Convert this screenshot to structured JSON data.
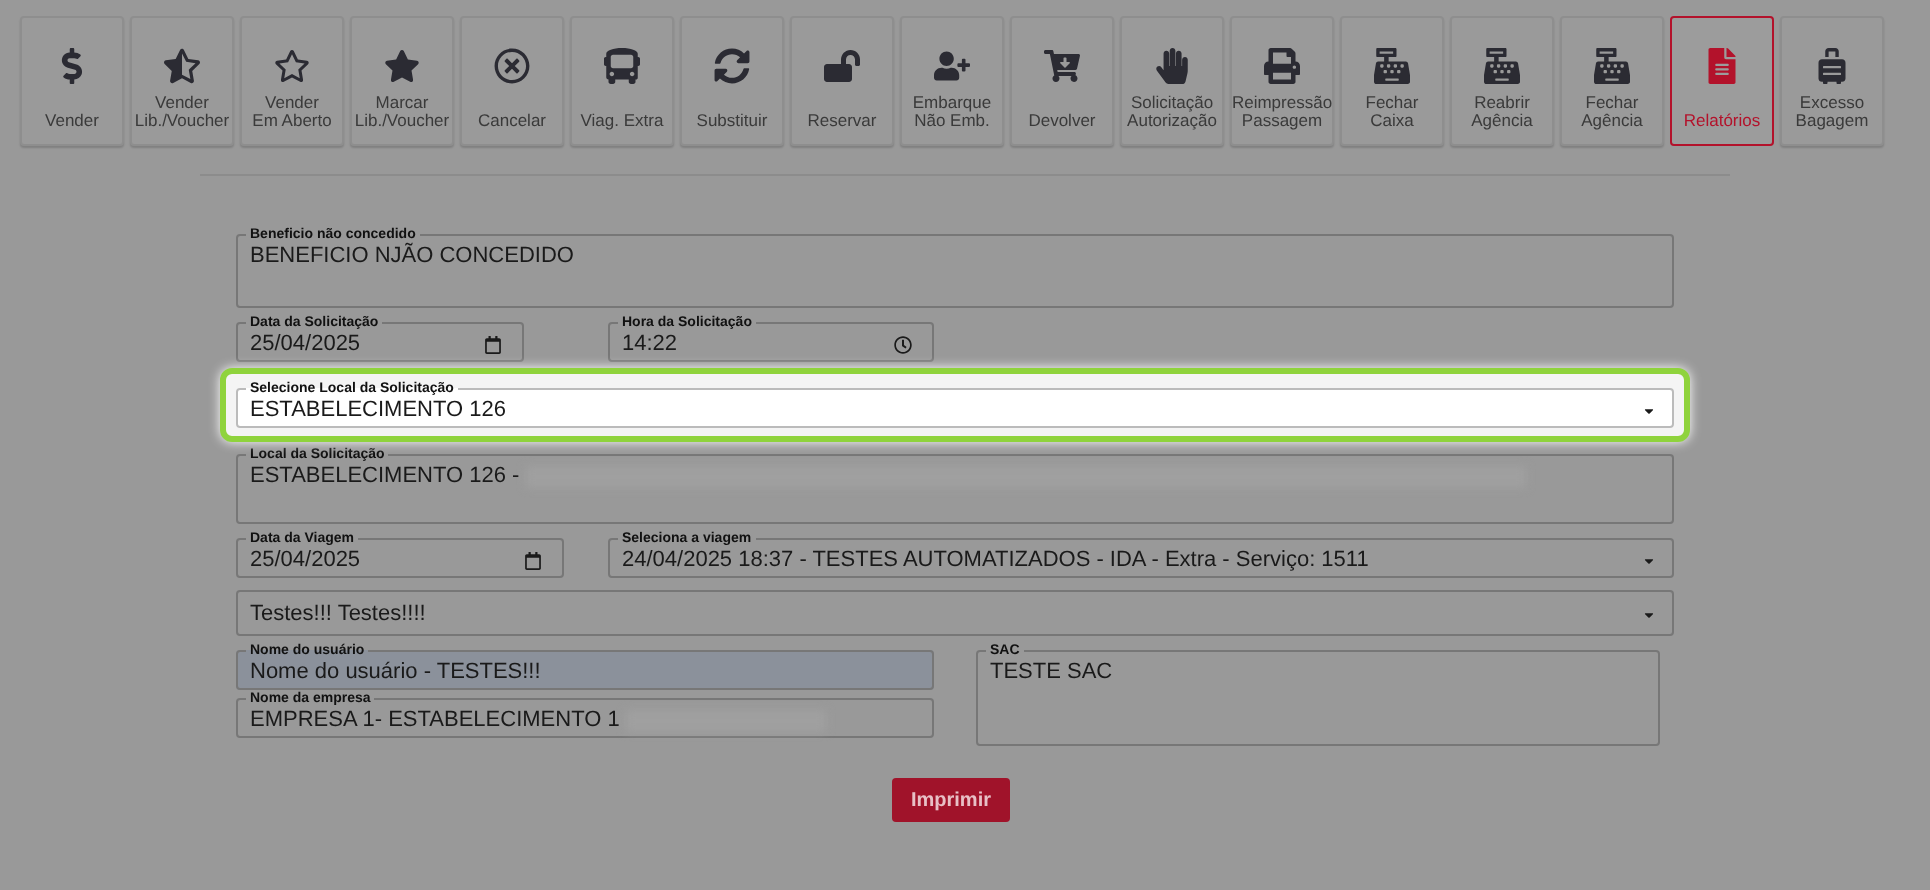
{
  "toolbar": {
    "buttons": [
      {
        "lines": [
          "Vender"
        ],
        "selected": false
      },
      {
        "lines": [
          "Vender",
          "Lib./Voucher"
        ],
        "selected": false
      },
      {
        "lines": [
          "Vender",
          "Em Aberto"
        ],
        "selected": false
      },
      {
        "lines": [
          "Marcar",
          "Lib./Voucher"
        ],
        "selected": false
      },
      {
        "lines": [
          "Cancelar"
        ],
        "selected": false
      },
      {
        "lines": [
          "Viag. Extra"
        ],
        "selected": false
      },
      {
        "lines": [
          "Substituir"
        ],
        "selected": false
      },
      {
        "lines": [
          "Reservar"
        ],
        "selected": false
      },
      {
        "lines": [
          "Embarque",
          "Não Emb."
        ],
        "selected": false
      },
      {
        "lines": [
          "Devolver"
        ],
        "selected": false
      },
      {
        "lines": [
          "Solicitação",
          "Autorização"
        ],
        "selected": false
      },
      {
        "lines": [
          "Reimpressão",
          "Passagem"
        ],
        "selected": false
      },
      {
        "lines": [
          "Fechar",
          "Caixa"
        ],
        "selected": false
      },
      {
        "lines": [
          "Reabrir",
          "Agência"
        ],
        "selected": false
      },
      {
        "lines": [
          "Fechar",
          "Agência"
        ],
        "selected": false
      },
      {
        "lines": [
          "Relatórios"
        ],
        "selected": true
      },
      {
        "lines": [
          "Excesso",
          "Bagagem"
        ],
        "selected": false
      }
    ]
  },
  "form": {
    "beneficio": {
      "label": "Beneficio não concedido",
      "value": "BENEFICIO NJÃO CONCEDIDO"
    },
    "data_solicitacao": {
      "label": "Data da Solicitação",
      "value": "25/04/2025"
    },
    "hora_solicitacao": {
      "label": "Hora da Solicitação",
      "value": "14:22"
    },
    "local_select": {
      "label": "Selecione Local da Solicitação",
      "value": "ESTABELECIMENTO 126",
      "highlighted": true
    },
    "local_solicitacao": {
      "label": "Local da Solicitação",
      "value": "ESTABELECIMENTO 126 -",
      "redacted": true
    },
    "data_viagem": {
      "label": "Data da Viagem",
      "value": "25/04/2025"
    },
    "viagem_select": {
      "label": "Seleciona a viagem",
      "value": "24/04/2025 18:37 - TESTES AUTOMATIZADOS - IDA - Extra - Serviço: 1511"
    },
    "testes_select": {
      "value": "Testes!!! Testes!!!!"
    },
    "nome_usuario": {
      "label": "Nome do usuário",
      "value": "Nome do usuário - TESTES!!!"
    },
    "nome_empresa": {
      "label": "Nome da empresa",
      "value": "EMPRESA 1- ESTABELECIMENTO 1",
      "redacted": true
    },
    "sac": {
      "label": "SAC",
      "value": "TESTE SAC"
    },
    "print_button": "Imprimir"
  }
}
